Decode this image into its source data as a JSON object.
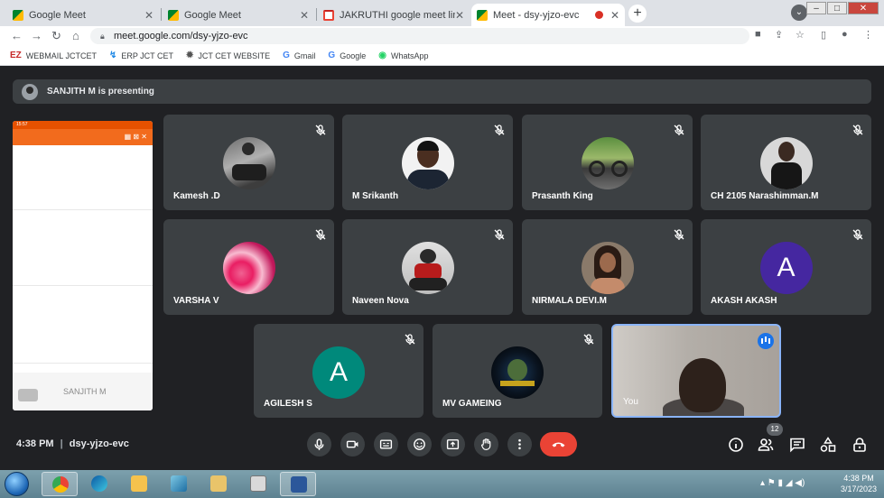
{
  "browser": {
    "tabs": [
      {
        "title": "Google Meet",
        "icon": "meet-icon",
        "active": false
      },
      {
        "title": "Google Meet",
        "icon": "meet-icon",
        "active": false
      },
      {
        "title": "JAKRUTHI google meet link - pc",
        "icon": "gmail-icon",
        "active": false
      },
      {
        "title": "Meet - dsy-yjzo-evc",
        "icon": "meet-icon",
        "active": true
      }
    ],
    "url": "meet.google.com/dsy-yjzo-evc",
    "bookmarks": [
      {
        "label": "WEBMAIL JCTCET",
        "icon": "EZ"
      },
      {
        "label": "ERP JCT CET",
        "icon": "↯"
      },
      {
        "label": "JCT CET WEBSITE",
        "icon": "✹"
      },
      {
        "label": "Gmail",
        "icon": "G"
      },
      {
        "label": "Google",
        "icon": "G"
      },
      {
        "label": "WhatsApp",
        "icon": "◉"
      }
    ]
  },
  "meet": {
    "presenting_text": "SANJITH M is presenting",
    "presenter_screen_label": "SANJITH M",
    "phone_status": "15:57",
    "participants": [
      {
        "name": "Kamesh .D",
        "avatar": "photo-bike"
      },
      {
        "name": "M Srikanth",
        "avatar": "photo-man"
      },
      {
        "name": "Prasanth King",
        "avatar": "photo-motorcycle"
      },
      {
        "name": "CH 2105 Narashimman.M",
        "avatar": "photo-man-dark"
      },
      {
        "name": "VARSHA V",
        "avatar": "photo-pink"
      },
      {
        "name": "Naveen Nova",
        "avatar": "photo-rider"
      },
      {
        "name": "NIRMALA DEVI.M",
        "avatar": "photo-woman"
      },
      {
        "name": "AKASH AKASH",
        "avatar": "letter",
        "letter": "A",
        "color": "#4527a0"
      },
      {
        "name": "AGILESH S",
        "avatar": "letter",
        "letter": "A",
        "color": "#00897b"
      },
      {
        "name": "MV GAMEING",
        "avatar": "photo-gaming-logo"
      },
      {
        "name": "You",
        "avatar": "video"
      }
    ],
    "meeting_time": "4:38 PM",
    "meeting_code": "dsy-yjzo-evc",
    "people_count": "12",
    "colors": {
      "background": "#202124",
      "tile": "#3c4043",
      "end_call": "#ea4335",
      "accent": "#8ab4f8"
    }
  },
  "taskbar": {
    "time": "4:38 PM",
    "date": "3/17/2023"
  }
}
